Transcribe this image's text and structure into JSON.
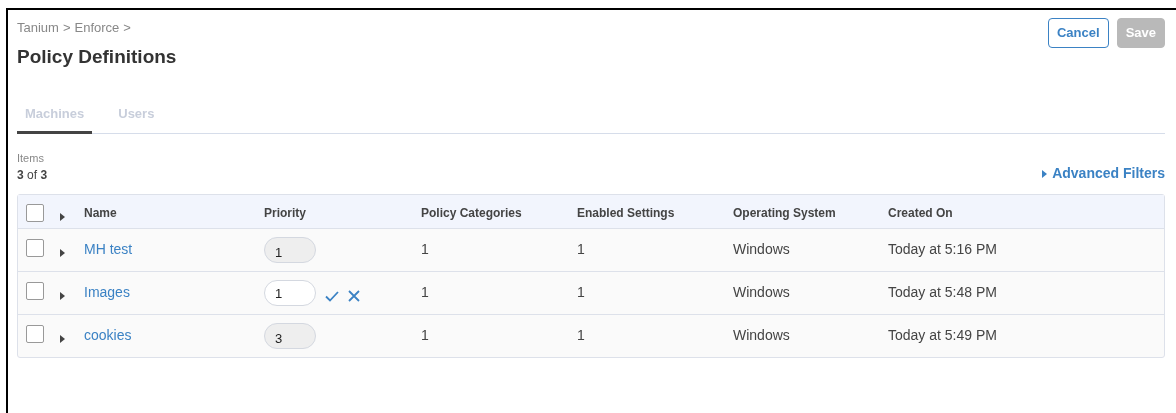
{
  "breadcrumb": {
    "items": [
      "Tanium",
      "Enforce"
    ],
    "separator": ">"
  },
  "title": "Policy Definitions",
  "buttons": [
    {
      "label": "Cancel",
      "kind": "outline",
      "disabled": false
    },
    {
      "label": "Save",
      "kind": "primary",
      "disabled": true
    }
  ],
  "tabs": [
    {
      "label": "Machines",
      "selected": true
    },
    {
      "label": "Users",
      "selected": false
    }
  ],
  "items": {
    "label": "Items",
    "count": "**3** of **3**"
  },
  "advanced_filters": {
    "label": "Advanced Filters",
    "expanded": false
  },
  "table": {
    "select_all_checked": false,
    "header_expanded": false,
    "columns": [
      "Name",
      "Priority",
      "Policy Categories",
      "Enabled Settings",
      "Operating System",
      "Created On"
    ],
    "rows": [
      {
        "checked": false,
        "expanded": false,
        "name": "MH test",
        "priority": {
          "value": "1",
          "editing": false
        },
        "policy_categories": "1",
        "enabled_settings": "1",
        "operating_system": "Windows",
        "created_on": "Today at 5:16 PM"
      },
      {
        "checked": false,
        "expanded": false,
        "name": "Images",
        "priority": {
          "value": "1",
          "editing": true
        },
        "policy_categories": "1",
        "enabled_settings": "1",
        "operating_system": "Windows",
        "created_on": "Today at 5:48 PM"
      },
      {
        "checked": false,
        "expanded": false,
        "name": "cookies",
        "priority": {
          "value": "3",
          "editing": false
        },
        "policy_categories": "1",
        "enabled_settings": "1",
        "operating_system": "Windows",
        "created_on": "Today at 5:49 PM"
      }
    ]
  }
}
